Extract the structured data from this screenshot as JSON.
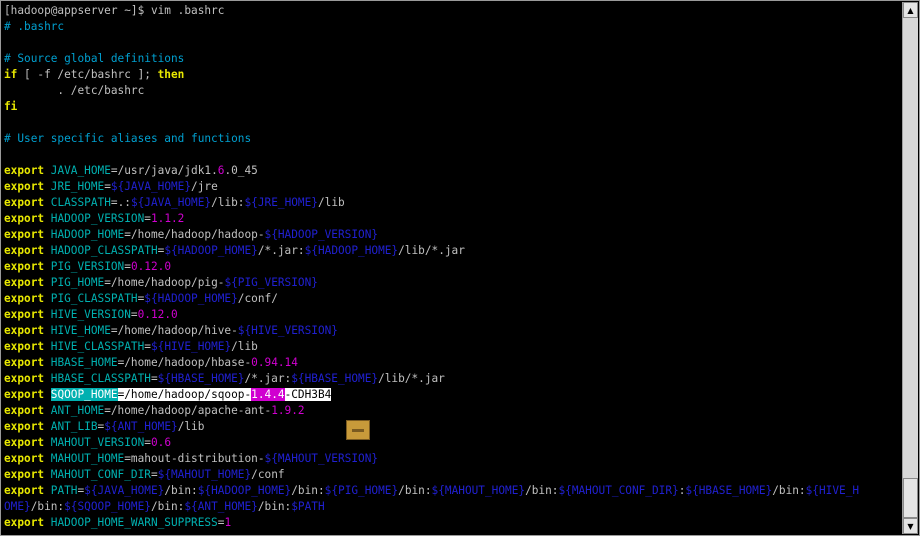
{
  "terminal": {
    "lines": [
      [
        {
          "c": "prompt",
          "t": "[hadoop@appserver ~]$ vim .bashrc"
        }
      ],
      [
        {
          "c": "cm",
          "t": "# .bashrc"
        }
      ],
      [],
      [
        {
          "c": "cm",
          "t": "# Source global definitions"
        }
      ],
      [
        {
          "c": "kw",
          "t": "if"
        },
        {
          "c": "str",
          "t": " [ -f /etc/bashrc ]; "
        },
        {
          "c": "kw",
          "t": "then"
        }
      ],
      [
        {
          "c": "str",
          "t": "        . /etc/bashrc"
        }
      ],
      [
        {
          "c": "kw",
          "t": "fi"
        }
      ],
      [],
      [
        {
          "c": "cm",
          "t": "# User specific aliases and functions"
        }
      ],
      [],
      [
        {
          "c": "kw",
          "t": "export"
        },
        {
          "c": "str",
          "t": " "
        },
        {
          "c": "var",
          "t": "JAVA_HOME"
        },
        {
          "c": "str",
          "t": "=/usr/java/jdk1."
        },
        {
          "c": "num",
          "t": "6"
        },
        {
          "c": "str",
          "t": ".0_45"
        }
      ],
      [
        {
          "c": "kw",
          "t": "export"
        },
        {
          "c": "str",
          "t": " "
        },
        {
          "c": "var",
          "t": "JRE_HOME"
        },
        {
          "c": "str",
          "t": "="
        },
        {
          "c": "sub",
          "t": "${JAVA_HOME}"
        },
        {
          "c": "str",
          "t": "/jre"
        }
      ],
      [
        {
          "c": "kw",
          "t": "export"
        },
        {
          "c": "str",
          "t": " "
        },
        {
          "c": "var",
          "t": "CLASSPATH"
        },
        {
          "c": "str",
          "t": "=.:"
        },
        {
          "c": "sub",
          "t": "${JAVA_HOME}"
        },
        {
          "c": "str",
          "t": "/lib:"
        },
        {
          "c": "sub",
          "t": "${JRE_HOME}"
        },
        {
          "c": "str",
          "t": "/lib"
        }
      ],
      [
        {
          "c": "kw",
          "t": "export"
        },
        {
          "c": "str",
          "t": " "
        },
        {
          "c": "var",
          "t": "HADOOP_VERSION"
        },
        {
          "c": "str",
          "t": "="
        },
        {
          "c": "num",
          "t": "1.1.2"
        }
      ],
      [
        {
          "c": "kw",
          "t": "export"
        },
        {
          "c": "str",
          "t": " "
        },
        {
          "c": "var",
          "t": "HADOOP_HOME"
        },
        {
          "c": "str",
          "t": "=/home/hadoop/hadoop-"
        },
        {
          "c": "sub",
          "t": "${HADOOP_VERSION}"
        }
      ],
      [
        {
          "c": "kw",
          "t": "export"
        },
        {
          "c": "str",
          "t": " "
        },
        {
          "c": "var",
          "t": "HADOOP_CLASSPATH"
        },
        {
          "c": "str",
          "t": "="
        },
        {
          "c": "sub",
          "t": "${HADOOP_HOME}"
        },
        {
          "c": "str",
          "t": "/*.jar:"
        },
        {
          "c": "sub",
          "t": "${HADOOP_HOME}"
        },
        {
          "c": "str",
          "t": "/lib/*.jar"
        }
      ],
      [
        {
          "c": "kw",
          "t": "export"
        },
        {
          "c": "str",
          "t": " "
        },
        {
          "c": "var",
          "t": "PIG_VERSION"
        },
        {
          "c": "str",
          "t": "="
        },
        {
          "c": "num",
          "t": "0.12.0"
        }
      ],
      [
        {
          "c": "kw",
          "t": "export"
        },
        {
          "c": "str",
          "t": " "
        },
        {
          "c": "var",
          "t": "PIG_HOME"
        },
        {
          "c": "str",
          "t": "=/home/hadoop/pig-"
        },
        {
          "c": "sub",
          "t": "${PIG_VERSION}"
        }
      ],
      [
        {
          "c": "kw",
          "t": "export"
        },
        {
          "c": "str",
          "t": " "
        },
        {
          "c": "var",
          "t": "PIG_CLASSPATH"
        },
        {
          "c": "str",
          "t": "="
        },
        {
          "c": "sub",
          "t": "${HADOOP_HOME}"
        },
        {
          "c": "str",
          "t": "/conf/"
        }
      ],
      [
        {
          "c": "kw",
          "t": "export"
        },
        {
          "c": "str",
          "t": " "
        },
        {
          "c": "var",
          "t": "HIVE_VERSION"
        },
        {
          "c": "str",
          "t": "="
        },
        {
          "c": "num",
          "t": "0.12.0"
        }
      ],
      [
        {
          "c": "kw",
          "t": "export"
        },
        {
          "c": "str",
          "t": " "
        },
        {
          "c": "var",
          "t": "HIVE_HOME"
        },
        {
          "c": "str",
          "t": "=/home/hadoop/hive-"
        },
        {
          "c": "sub",
          "t": "${HIVE_VERSION}"
        }
      ],
      [
        {
          "c": "kw",
          "t": "export"
        },
        {
          "c": "str",
          "t": " "
        },
        {
          "c": "var",
          "t": "HIVE_CLASSPATH"
        },
        {
          "c": "str",
          "t": "="
        },
        {
          "c": "sub",
          "t": "${HIVE_HOME}"
        },
        {
          "c": "str",
          "t": "/lib"
        }
      ],
      [
        {
          "c": "kw",
          "t": "export"
        },
        {
          "c": "str",
          "t": " "
        },
        {
          "c": "var",
          "t": "HBASE_HOME"
        },
        {
          "c": "str",
          "t": "=/home/hadoop/hbase-"
        },
        {
          "c": "num",
          "t": "0.94.14"
        }
      ],
      [
        {
          "c": "kw",
          "t": "export"
        },
        {
          "c": "str",
          "t": " "
        },
        {
          "c": "var",
          "t": "HBASE_CLASSPATH"
        },
        {
          "c": "str",
          "t": "="
        },
        {
          "c": "sub",
          "t": "${HBASE_HOME}"
        },
        {
          "c": "str",
          "t": "/*.jar:"
        },
        {
          "c": "sub",
          "t": "${HBASE_HOME}"
        },
        {
          "c": "str",
          "t": "/lib/*.jar"
        }
      ],
      [
        {
          "c": "kw",
          "t": "export"
        },
        {
          "c": "str",
          "t": " "
        },
        {
          "c": "sel",
          "t": "SQOOP_HOME"
        },
        {
          "c": "selw",
          "t": "=/home/hadoop/sqoop-"
        },
        {
          "c": "seln",
          "t": "1.4.4"
        },
        {
          "c": "selw",
          "t": "-CDH3B4"
        }
      ],
      [
        {
          "c": "kw",
          "t": "export"
        },
        {
          "c": "str",
          "t": " "
        },
        {
          "c": "var",
          "t": "ANT_HOME"
        },
        {
          "c": "str",
          "t": "=/home/hadoop/apache-ant-"
        },
        {
          "c": "num",
          "t": "1.9.2"
        }
      ],
      [
        {
          "c": "kw",
          "t": "export"
        },
        {
          "c": "str",
          "t": " "
        },
        {
          "c": "var",
          "t": "ANT_LIB"
        },
        {
          "c": "str",
          "t": "="
        },
        {
          "c": "sub",
          "t": "${ANT_HOME}"
        },
        {
          "c": "str",
          "t": "/lib"
        }
      ],
      [
        {
          "c": "kw",
          "t": "export"
        },
        {
          "c": "str",
          "t": " "
        },
        {
          "c": "var",
          "t": "MAHOUT_VERSION"
        },
        {
          "c": "str",
          "t": "="
        },
        {
          "c": "num",
          "t": "0.6"
        }
      ],
      [
        {
          "c": "kw",
          "t": "export"
        },
        {
          "c": "str",
          "t": " "
        },
        {
          "c": "var",
          "t": "MAHOUT_HOME"
        },
        {
          "c": "str",
          "t": "=mahout-distribution-"
        },
        {
          "c": "sub",
          "t": "${MAHOUT_VERSION}"
        }
      ],
      [
        {
          "c": "kw",
          "t": "export"
        },
        {
          "c": "str",
          "t": " "
        },
        {
          "c": "var",
          "t": "MAHOUT_CONF_DIR"
        },
        {
          "c": "str",
          "t": "="
        },
        {
          "c": "sub",
          "t": "${MAHOUT_HOME}"
        },
        {
          "c": "str",
          "t": "/conf"
        }
      ],
      [
        {
          "c": "kw",
          "t": "export"
        },
        {
          "c": "str",
          "t": " "
        },
        {
          "c": "var",
          "t": "PATH"
        },
        {
          "c": "str",
          "t": "="
        },
        {
          "c": "sub",
          "t": "${JAVA_HOME}"
        },
        {
          "c": "str",
          "t": "/bin:"
        },
        {
          "c": "sub",
          "t": "${HADOOP_HOME}"
        },
        {
          "c": "str",
          "t": "/bin:"
        },
        {
          "c": "sub",
          "t": "${PIG_HOME}"
        },
        {
          "c": "str",
          "t": "/bin:"
        },
        {
          "c": "sub",
          "t": "${MAHOUT_HOME}"
        },
        {
          "c": "str",
          "t": "/bin:"
        },
        {
          "c": "sub",
          "t": "${MAHOUT_CONF_DIR}"
        },
        {
          "c": "str",
          "t": ":"
        },
        {
          "c": "sub",
          "t": "${HBASE_HOME}"
        },
        {
          "c": "str",
          "t": "/bin:"
        },
        {
          "c": "sub",
          "t": "${HIVE_H"
        }
      ],
      [
        {
          "c": "sub",
          "t": "OME}"
        },
        {
          "c": "str",
          "t": "/bin:"
        },
        {
          "c": "sub",
          "t": "${SQOOP_HOME}"
        },
        {
          "c": "str",
          "t": "/bin:"
        },
        {
          "c": "sub",
          "t": "${ANT_HOME}"
        },
        {
          "c": "str",
          "t": "/bin:"
        },
        {
          "c": "sub",
          "t": "$PATH"
        }
      ],
      [
        {
          "c": "kw",
          "t": "export"
        },
        {
          "c": "str",
          "t": " "
        },
        {
          "c": "var",
          "t": "HADOOP_HOME_WARN_SUPPRESS"
        },
        {
          "c": "str",
          "t": "="
        },
        {
          "c": "num",
          "t": "1"
        }
      ]
    ]
  },
  "scrollbar": {
    "up_glyph": "▲",
    "down_glyph": "▼",
    "position": 1.0
  },
  "colors": {
    "background": "#000000",
    "comment": "#00a0d0",
    "keyword": "#e8e800",
    "variable": "#00b0b0",
    "substitution": "#2020d0",
    "number": "#d000d0"
  },
  "icons": {
    "overlay": "folder-icon"
  }
}
